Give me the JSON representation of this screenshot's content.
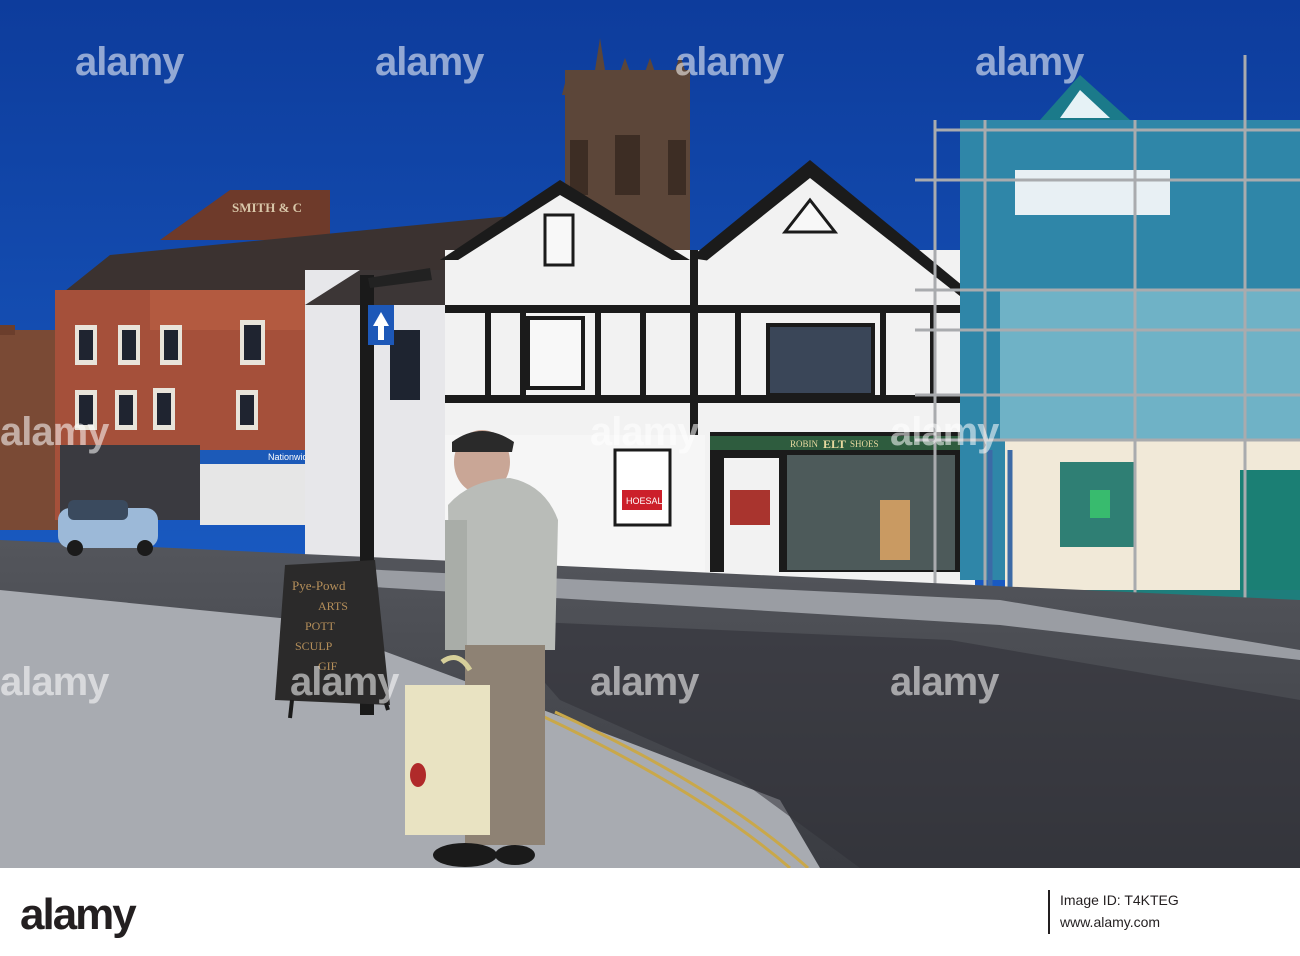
{
  "photo": {
    "signs": {
      "smith": "SMITH & C",
      "nationwide": "Nationwide",
      "robin": "ROBIN",
      "elt": "ELT",
      "shoes": "SHOES",
      "shoesale": "HOESAL",
      "aboard": [
        "Pye-Powd",
        "ARTS",
        "POTT",
        "SCULP",
        "GIF"
      ]
    }
  },
  "watermark": {
    "text": "alamy"
  },
  "footer": {
    "logo": "alamy",
    "image_id": "Image ID: T4KTEG",
    "url": "www.alamy.com"
  }
}
